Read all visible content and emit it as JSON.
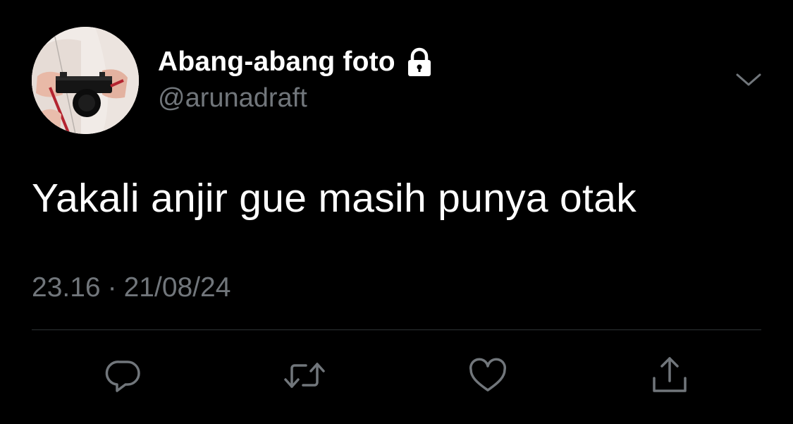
{
  "tweet": {
    "display_name": "Abang-abang foto",
    "handle": "@arunadraft",
    "protected_icon": "lock-icon",
    "text": "Yakali anjir gue masih punya otak",
    "time": "23.16",
    "separator": "·",
    "date": "21/08/24"
  },
  "icons": {
    "more": "chevron-down-icon",
    "reply": "reply-icon",
    "retweet": "retweet-icon",
    "like": "heart-icon",
    "share": "share-icon"
  },
  "colors": {
    "background": "#000000",
    "primary_text": "#ffffff",
    "secondary_text": "#71767b",
    "divider": "#2f3336"
  }
}
